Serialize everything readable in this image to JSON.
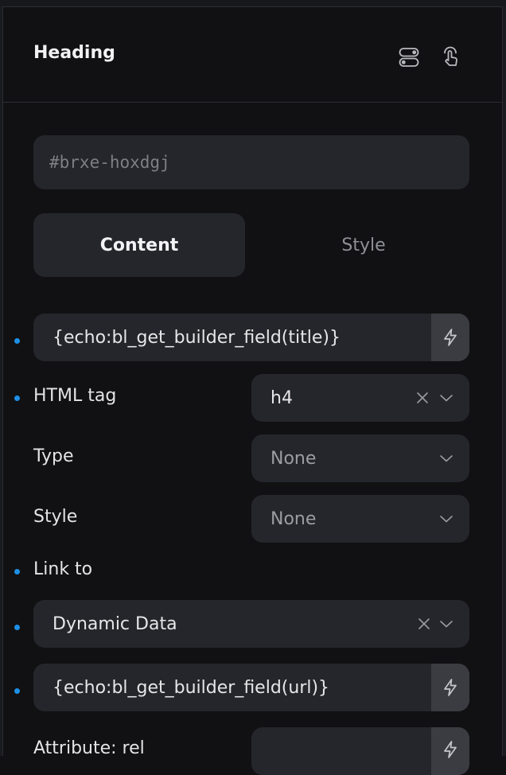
{
  "header": {
    "title": "Heading",
    "icons": [
      "toggle-switch-icon",
      "pointer-hand-icon"
    ]
  },
  "element_id": {
    "placeholder": "#brxe-hoxdgj"
  },
  "tabs": [
    {
      "label": "Content",
      "active": true
    },
    {
      "label": "Style",
      "active": false
    }
  ],
  "fields": {
    "text_value": "{echo:bl_get_builder_field(title)}",
    "html_tag": {
      "label": "HTML tag",
      "value": "h4"
    },
    "type": {
      "label": "Type",
      "value": "None"
    },
    "style": {
      "label": "Style",
      "value": "None"
    },
    "link_to": {
      "label": "Link to",
      "value": "Dynamic Data"
    },
    "link_value": "{echo:bl_get_builder_field(url)}",
    "attribute_rel": {
      "label": "Attribute: rel"
    }
  },
  "colors": {
    "background": "#111113",
    "field": "#25262b",
    "accent_dot": "#1e8fe6",
    "dynamic_button": "#3b3c41"
  }
}
